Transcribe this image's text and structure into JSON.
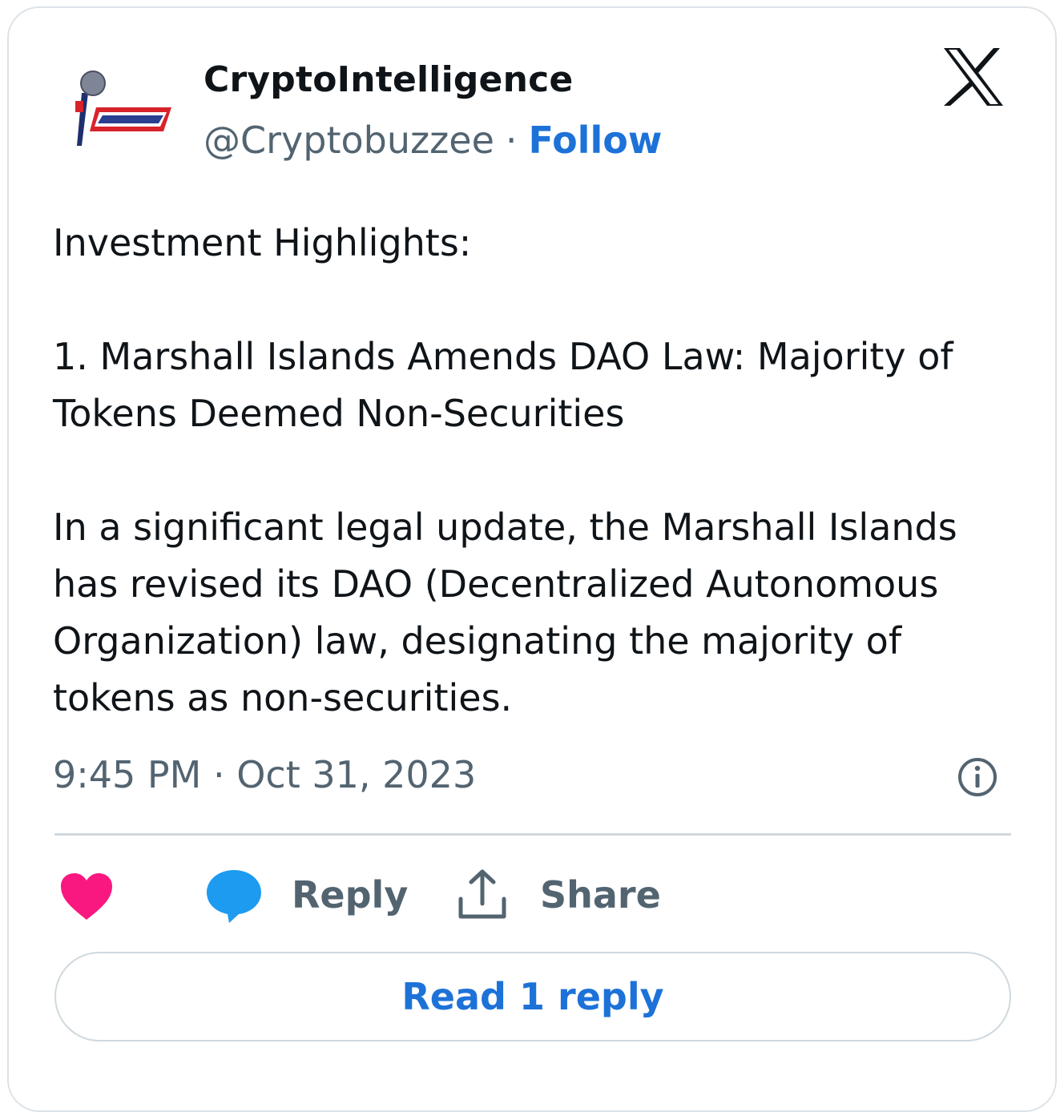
{
  "colors": {
    "accent": "#1d72d8",
    "muted_text": "#536471",
    "text": "#0f1419",
    "heart": "#f91880",
    "bubble": "#1d9bf0",
    "border": "#cfd9de"
  },
  "author": {
    "name": "CryptoIntelligence",
    "handle": "@Cryptobuzzee",
    "separator": "·",
    "follow_label": "Follow",
    "avatar_icon": "microphone-logo"
  },
  "platform_icon": "x-logo",
  "tweet": {
    "lines": [
      "Investment Highlights:",
      "",
      "1. Marshall Islands Amends DAO Law: Majority of",
      "Tokens Deemed Non-Securities",
      "",
      "In a significant legal update, the Marshall Islands",
      "has revised its DAO (Decentralized Autonomous",
      "Organization) law, designating the majority of",
      "tokens as non-securities."
    ],
    "timestamp": "9:45 PM · Oct 31, 2023"
  },
  "actions": {
    "like_icon": "heart-icon",
    "reply_icon": "speech-bubble-icon",
    "reply_label": "Reply",
    "share_icon": "share-upload-icon",
    "share_label": "Share"
  },
  "read_replies_label": "Read 1 reply"
}
